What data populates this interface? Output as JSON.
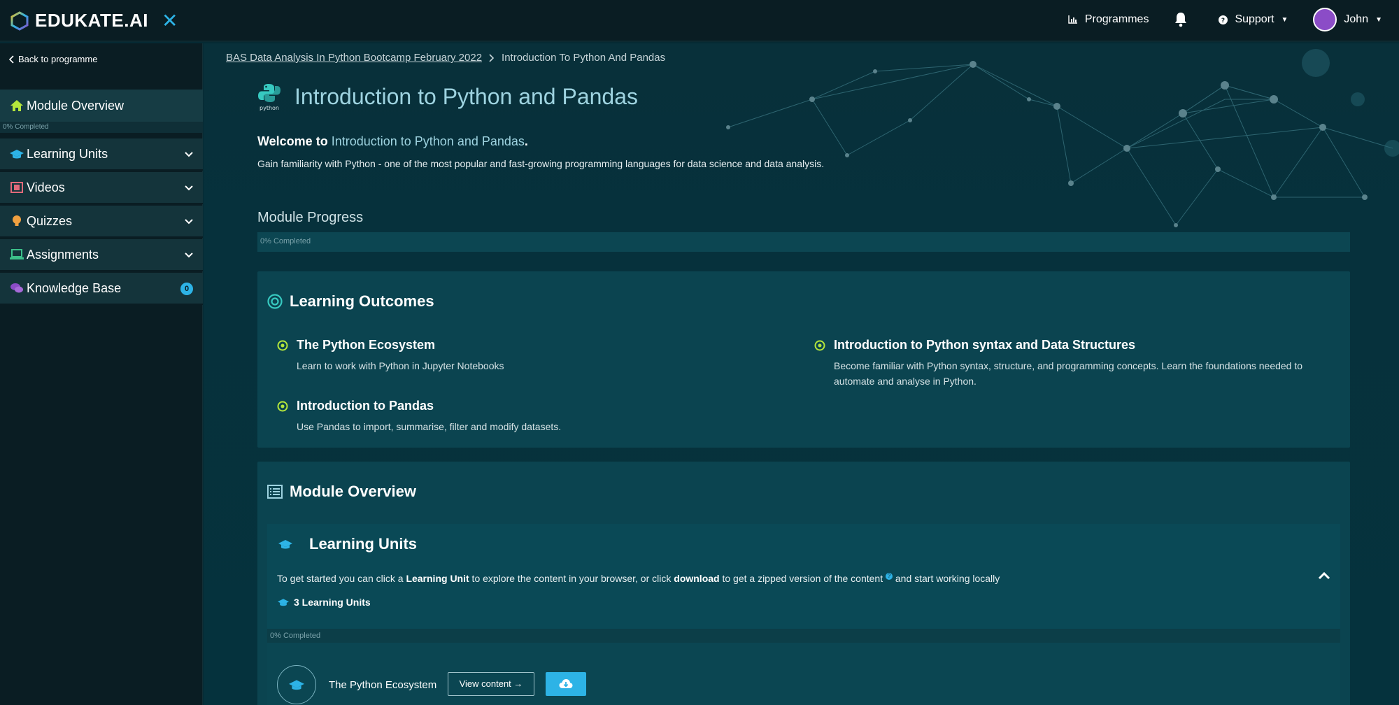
{
  "app": {
    "logo_text": "EDUKATE.AI",
    "close_glyph": "✕"
  },
  "topnav": {
    "programmes_label": "Programmes",
    "support_label": "Support",
    "user_name": "John"
  },
  "sidebar": {
    "back_label": "Back to programme",
    "active": {
      "label": "Module Overview",
      "icon": "home-icon"
    },
    "progress_label": "0% Completed",
    "items": [
      {
        "label": "Learning Units",
        "icon": "graduation-cap-icon",
        "color": "#2db3e6"
      },
      {
        "label": "Videos",
        "icon": "film-icon",
        "color": "#e06a7a"
      },
      {
        "label": "Quizzes",
        "icon": "lightbulb-icon",
        "color": "#f0a040"
      },
      {
        "label": "Assignments",
        "icon": "laptop-icon",
        "color": "#3cc08a"
      },
      {
        "label": "Knowledge Base",
        "icon": "comments-icon",
        "color": "#8b4cc7",
        "badge": "0"
      }
    ]
  },
  "breadcrumb": {
    "parent": "BAS Data Analysis In Python Bootcamp February 2022",
    "current": "Introduction To Python And Pandas"
  },
  "page": {
    "python_logo_caption": "python",
    "title": "Introduction to Python and Pandas",
    "welcome_prefix": "Welcome to ",
    "welcome_highlight": "Introduction to Python and Pandas",
    "welcome_suffix": ".",
    "description": "Gain familiarity with Python - one of the most popular and fast-growing programming languages for data science and data analysis."
  },
  "module_progress": {
    "title": "Module Progress",
    "label": "0% Completed",
    "value": 0
  },
  "learning_outcomes": {
    "title": "Learning Outcomes",
    "items": [
      {
        "title": "The Python Ecosystem",
        "desc": "Learn to work with Python in Jupyter Notebooks"
      },
      {
        "title": "Introduction to Python syntax and Data Structures",
        "desc": "Become familiar with Python syntax, structure, and programming concepts. Learn the foundations needed to automate and analyse in Python."
      },
      {
        "title": "Introduction to Pandas",
        "desc": "Use Pandas to import, summarise, filter and modify datasets."
      }
    ]
  },
  "module_overview": {
    "title": "Module Overview",
    "learning_units": {
      "title": "Learning Units",
      "intro_1": "To get started you can click a ",
      "intro_b1": "Learning Unit",
      "intro_2": " to explore the content in your browser, or click ",
      "intro_b2": "download",
      "intro_3": " to get a zipped version of the content ",
      "intro_q": "?",
      "intro_4": " and start working locally",
      "count_label": "3 Learning Units",
      "progress_label": "0% Completed",
      "units": [
        {
          "name": "The Python Ecosystem",
          "view_label": "View content →"
        }
      ]
    }
  },
  "colors": {
    "accent": "#2db3e6",
    "highlight_text": "#9ed3e0",
    "outcome_dot": "#b4e63c"
  }
}
